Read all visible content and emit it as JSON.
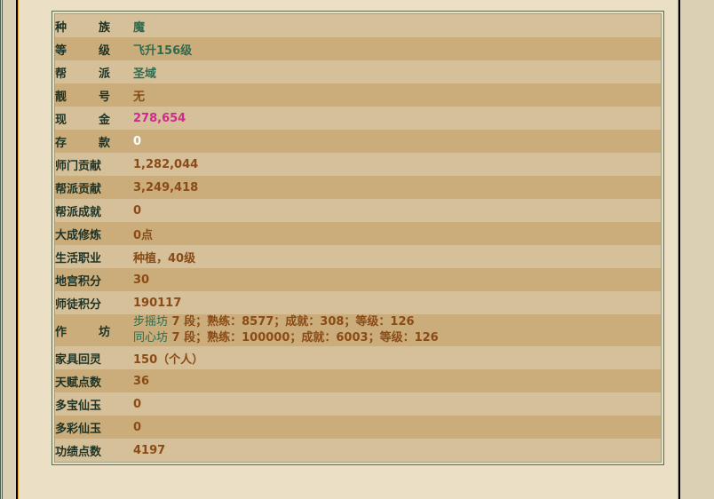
{
  "page": {
    "background_color": "#dcd0b4",
    "content_background_color": "#ebdfc5",
    "accent_rule_color": "#e9a33b"
  },
  "panel": {
    "border_color": "#5d6b4e",
    "inner_border_color": "#9aa487",
    "row_color_a": "#d6c09a",
    "row_color_b": "#cbad7c"
  },
  "colors": {
    "label": "#1d3326",
    "green": "#2e6b4f",
    "brown": "#8a4b16",
    "pink": "#cf2a8c",
    "white": "#ffffff"
  },
  "stats": {
    "rows": [
      {
        "label": "种族",
        "spread": true,
        "value": "魔",
        "value_color": "green"
      },
      {
        "label": "等级",
        "spread": true,
        "value": "飞升156级",
        "value_color": "green"
      },
      {
        "label": "帮派",
        "spread": true,
        "value": "圣域",
        "value_color": "green"
      },
      {
        "label": "靓号",
        "spread": true,
        "value": "无",
        "value_color": "brown"
      },
      {
        "label": "现金",
        "spread": true,
        "value": "278,654",
        "value_color": "pink"
      },
      {
        "label": "存款",
        "spread": true,
        "value": "0",
        "value_color": "white"
      },
      {
        "label": "师门贡献",
        "spread": false,
        "value": "1,282,044",
        "value_color": "brown"
      },
      {
        "label": "帮派贡献",
        "spread": false,
        "value": "3,249,418",
        "value_color": "brown"
      },
      {
        "label": "帮派成就",
        "spread": false,
        "value": "0",
        "value_color": "brown"
      },
      {
        "label": "大成修炼",
        "spread": false,
        "value": "0点",
        "value_color": "brown"
      },
      {
        "label": "生活职业",
        "spread": false,
        "value": "种植，40级",
        "value_color": "brown"
      },
      {
        "label": "地宫积分",
        "spread": false,
        "value": "30",
        "value_color": "brown"
      },
      {
        "label": "师徒积分",
        "spread": false,
        "value": "190117",
        "value_color": "brown"
      }
    ],
    "workshop_row": {
      "label": "作坊",
      "spread": true,
      "lines": [
        {
          "name": "步摇坊",
          "detail": " 7 段；熟练：8577；成就：308；等级：126"
        },
        {
          "name": "同心坊",
          "detail": " 7 段；熟练：100000；成就：6003；等级：126"
        }
      ]
    },
    "rows_after": [
      {
        "label": "家具回灵",
        "spread": false,
        "value": "150（个人）",
        "value_color": "brown"
      },
      {
        "label": "天赋点数",
        "spread": false,
        "value": "36",
        "value_color": "brown"
      },
      {
        "label": "多宝仙玉",
        "spread": false,
        "value": "0",
        "value_color": "brown"
      },
      {
        "label": "多彩仙玉",
        "spread": false,
        "value": "0",
        "value_color": "brown"
      },
      {
        "label": "功绩点数",
        "spread": false,
        "value": "4197",
        "value_color": "brown"
      }
    ]
  }
}
